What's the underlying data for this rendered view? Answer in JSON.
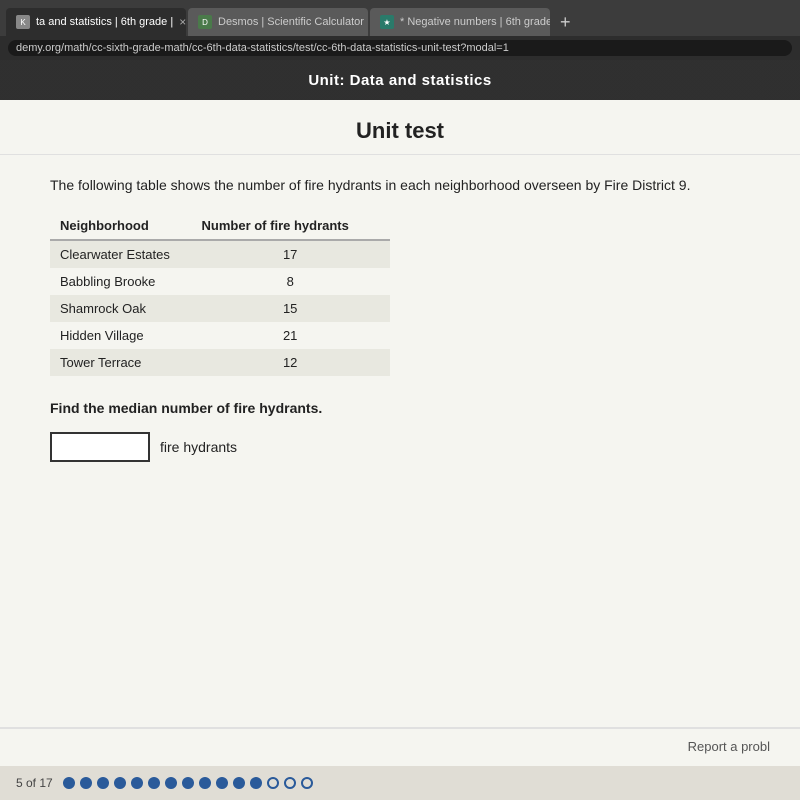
{
  "browser": {
    "tabs": [
      {
        "id": "tab1",
        "label": "ta and statistics | 6th grade |",
        "favicon_type": "default",
        "active": true,
        "close_label": "×"
      },
      {
        "id": "tab2",
        "label": "Desmos | Scientific Calculator",
        "favicon_type": "green",
        "favicon_char": "D",
        "active": false,
        "close_label": "×"
      },
      {
        "id": "tab3",
        "label": "* Negative numbers | 6th grade",
        "favicon_type": "teal",
        "favicon_char": "★",
        "active": false,
        "close_label": "×"
      }
    ],
    "new_tab_label": "+",
    "address_bar": "demy.org/math/cc-sixth-grade-math/cc-6th-data-statistics/test/cc-6th-data-statistics-unit-test?modal=1"
  },
  "unit_banner": {
    "text": "Unit: Data and statistics"
  },
  "page": {
    "title": "Unit test",
    "question_text": "The following table shows the number of fire hydrants in each neighborhood overseen by Fire District 9.",
    "table": {
      "headers": [
        "Neighborhood",
        "Number of fire hydrants"
      ],
      "rows": [
        [
          "Clearwater Estates",
          "17"
        ],
        [
          "Babbling Brooke",
          "8"
        ],
        [
          "Shamrock Oak",
          "15"
        ],
        [
          "Hidden Village",
          "21"
        ],
        [
          "Tower Terrace",
          "12"
        ]
      ]
    },
    "find_median_label": "Find the median number of fire hydrants.",
    "answer_input_placeholder": "",
    "answer_unit_label": "fire hydrants",
    "report_label": "Report a probl"
  },
  "progress": {
    "label": "5 of 17",
    "filled_dots": 12,
    "empty_dots": 3
  }
}
